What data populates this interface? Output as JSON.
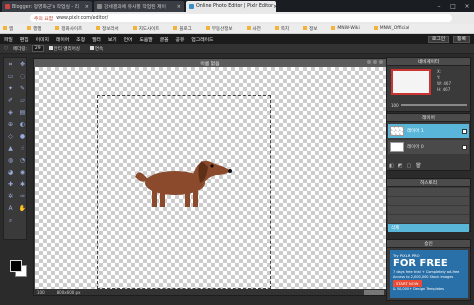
{
  "browser": {
    "tabs": [
      {
        "title": "Blogger: 정영화군's 작업실 - 리",
        "active": false
      },
      {
        "title": "강세결과에 유사할 작업된 제이",
        "active": false
      },
      {
        "title": "Online Photo Editor | Pixlr Editor",
        "active": true
      }
    ],
    "url": "www.pixlr.com/editor/",
    "security_warning": "주의 요함",
    "bookmarks": [
      "앱",
      "행행",
      "정화사이즈",
      "정보라서",
      "지도사이트",
      "블로그",
      "부동산정보",
      "사전",
      "쪽지",
      "정보",
      "MNW-Wiki",
      "MNW_Official"
    ]
  },
  "menubar": {
    "items": [
      "파일",
      "편집",
      "이미지",
      "레이어",
      "조정",
      "필터",
      "보기",
      "언어",
      "도움말",
      "글꼴",
      "공유",
      "업그레이드"
    ],
    "login": "로그인",
    "signup": "등록"
  },
  "options": {
    "feather_label": "페더링:",
    "feather_value": "29",
    "antialias": "안티 앨리어싱",
    "smooth": "연속"
  },
  "document": {
    "title": "이름 없음",
    "zoom": "100",
    "size": "800x600 px"
  },
  "navigator": {
    "title": "네비게이터",
    "x_label": "X:",
    "y_label": "Y:",
    "w_label": "W:",
    "h_label": "H:",
    "w_value": "467",
    "h_value": "467",
    "zoom": "100"
  },
  "layers": {
    "title": "레이어",
    "items": [
      {
        "name": "레이어 1",
        "selected": true
      },
      {
        "name": "레이어 0",
        "selected": false
      }
    ]
  },
  "history": {
    "title": "히스토리",
    "items": [
      {
        "name": "",
        "selected": false
      },
      {
        "name": "",
        "selected": false
      },
      {
        "name": "",
        "selected": false
      },
      {
        "name": "",
        "selected": false
      },
      {
        "name": "삭제",
        "selected": true
      }
    ]
  },
  "ad": {
    "title": "승인",
    "small": "Try PIXLR PRO",
    "headline": "FOR FREE",
    "line1": "7 days free trial + Completely ad-free",
    "line2": "Access to 2,000,000 Stock Images",
    "cta": "START NOW",
    "line3": "& 50,000+ Design Templates"
  },
  "colors": {
    "accent": "#5ab6d8",
    "dog": "#8b4a2b"
  }
}
